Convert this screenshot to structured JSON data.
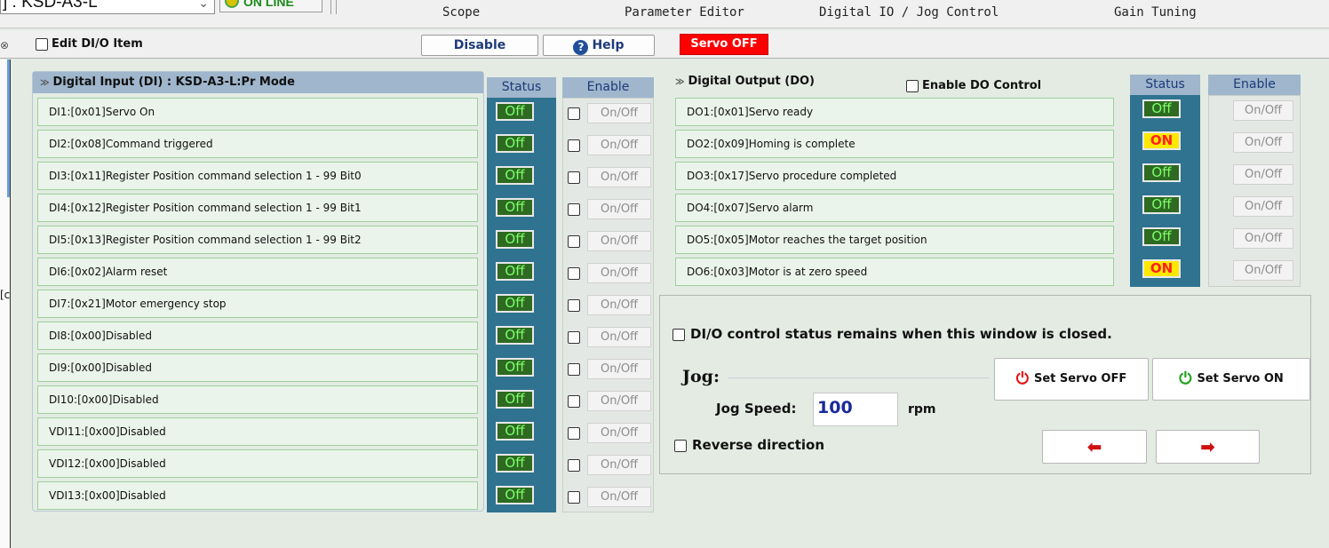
{
  "toolbar": {
    "device": "] : KSD-A3-L",
    "status": "ON LINE",
    "tabs": [
      "Scope",
      "Parameter Editor",
      "Digital IO / Jog Control",
      "Gain Tuning"
    ]
  },
  "bar2": {
    "close_glyph": "⊗",
    "edit_item": "Edit DI/O Item",
    "disable": "Disable",
    "help": "Help",
    "servo_state": "Servo OFF"
  },
  "left_edge_text": "[c",
  "di": {
    "title": "Digital Input (DI) : KSD-A3-L:Pr Mode",
    "status_header": "Status",
    "enable_header": "Enable",
    "onoff": "On/Off",
    "items": [
      {
        "label": "DI1:[0x01]Servo On",
        "status": "Off"
      },
      {
        "label": "DI2:[0x08]Command triggered",
        "status": "Off"
      },
      {
        "label": "DI3:[0x11]Register Position command selection 1 - 99 Bit0",
        "status": "Off"
      },
      {
        "label": "DI4:[0x12]Register Position command selection 1 - 99 Bit1",
        "status": "Off"
      },
      {
        "label": "DI5:[0x13]Register Position command selection 1 - 99 Bit2",
        "status": "Off"
      },
      {
        "label": "DI6:[0x02]Alarm reset",
        "status": "Off"
      },
      {
        "label": "DI7:[0x21]Motor emergency stop",
        "status": "Off"
      },
      {
        "label": "DI8:[0x00]Disabled",
        "status": "Off"
      },
      {
        "label": "DI9:[0x00]Disabled",
        "status": "Off"
      },
      {
        "label": "DI10:[0x00]Disabled",
        "status": "Off"
      },
      {
        "label": "VDI11:[0x00]Disabled",
        "status": "Off"
      },
      {
        "label": "VDI12:[0x00]Disabled",
        "status": "Off"
      },
      {
        "label": "VDI13:[0x00]Disabled",
        "status": "Off"
      }
    ]
  },
  "do": {
    "title": "Digital Output (DO)",
    "enable_control": "Enable DO Control",
    "status_header": "Status",
    "enable_header": "Enable",
    "onoff": "On/Off",
    "items": [
      {
        "label": "DO1:[0x01]Servo ready",
        "status": "Off"
      },
      {
        "label": "DO2:[0x09]Homing is complete",
        "status": "ON"
      },
      {
        "label": "DO3:[0x17]Servo procedure completed",
        "status": "Off"
      },
      {
        "label": "DO4:[0x07]Servo alarm",
        "status": "Off"
      },
      {
        "label": "DO5:[0x05]Motor reaches the target position",
        "status": "Off"
      },
      {
        "label": "DO6:[0x03]Motor is at zero speed",
        "status": "ON"
      }
    ]
  },
  "jog": {
    "remain_status": "DI/O control status remains when this window is closed.",
    "title": "Jog:",
    "speed_label": "Jog Speed:",
    "speed_value": "100",
    "unit": "rpm",
    "reverse": "Reverse direction",
    "set_servo_off": "Set Servo OFF",
    "set_servo_on": "Set Servo ON"
  }
}
